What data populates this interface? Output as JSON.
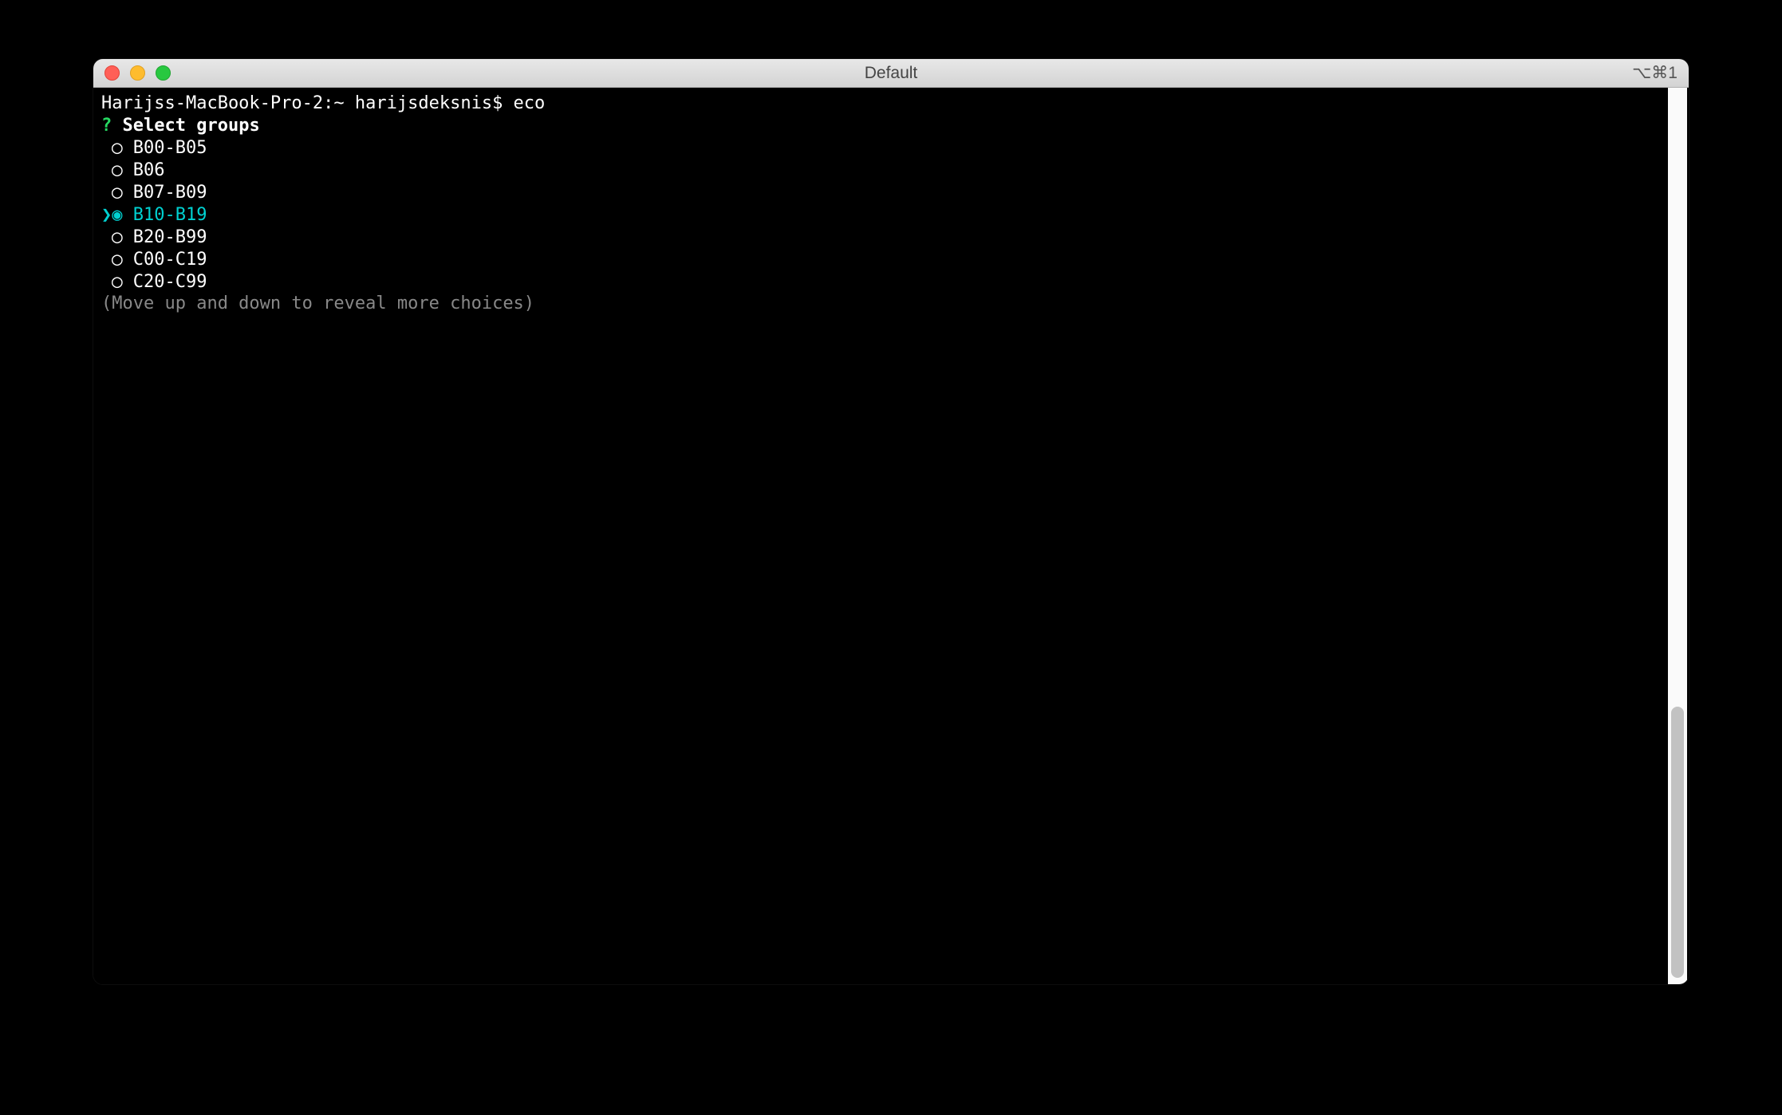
{
  "titlebar": {
    "title": "Default",
    "shortcut": "⌥⌘1"
  },
  "terminal": {
    "prompt_line": "Harijss-MacBook-Pro-2:~ harijsdeksnis$ eco",
    "question_mark": "?",
    "prompt_label": "Select groups",
    "choices": [
      {
        "label": "B00-B05",
        "selected": false
      },
      {
        "label": "B06",
        "selected": false
      },
      {
        "label": "B07-B09",
        "selected": false
      },
      {
        "label": "B10-B19",
        "selected": true
      },
      {
        "label": "B20-B99",
        "selected": false
      },
      {
        "label": "C00-C19",
        "selected": false
      },
      {
        "label": "C20-C99",
        "selected": false
      }
    ],
    "hint": "(Move up and down to reveal more choices)"
  }
}
